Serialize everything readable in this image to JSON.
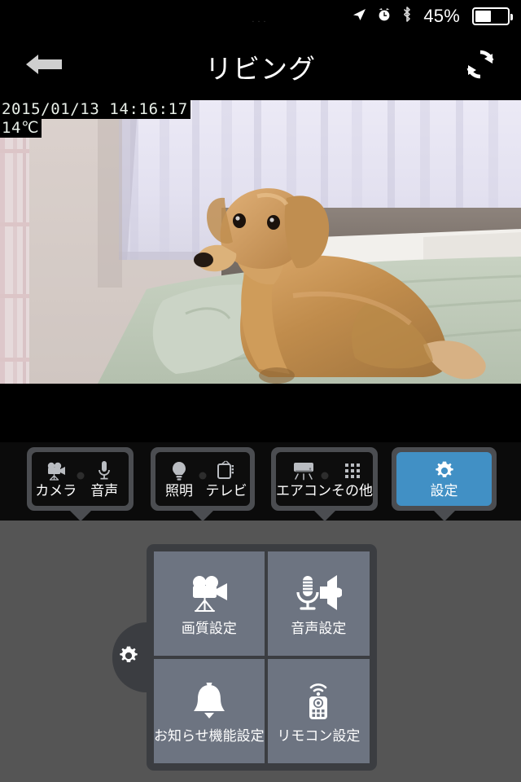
{
  "status_bar": {
    "carrier_dots": "...",
    "battery_percent": "45%",
    "battery_level": 45,
    "icons": [
      "location-arrow-icon",
      "alarm-clock-icon",
      "bluetooth-icon",
      "battery-icon"
    ]
  },
  "nav": {
    "title": "リビング",
    "back_icon": "back-arrow-icon",
    "refresh_icon": "refresh-icon"
  },
  "video": {
    "timestamp": "2015/01/13 14:16:17",
    "temperature": "14℃",
    "scene_description": "living room camera feed"
  },
  "tabs": [
    {
      "id": "camera-audio",
      "active": false,
      "cells": [
        {
          "label": "カメラ",
          "icon": "video-camera-icon"
        },
        {
          "label": "音声",
          "icon": "microphone-icon"
        }
      ]
    },
    {
      "id": "light-tv",
      "active": false,
      "cells": [
        {
          "label": "照明",
          "icon": "lightbulb-icon"
        },
        {
          "label": "テレビ",
          "icon": "television-icon"
        }
      ]
    },
    {
      "id": "aircon-other",
      "active": false,
      "cells": [
        {
          "label": "エアコン",
          "icon": "air-conditioner-icon"
        },
        {
          "label": "その他",
          "icon": "grid-dots-icon"
        }
      ]
    },
    {
      "id": "settings",
      "active": true,
      "cells": [
        {
          "label": "設定",
          "icon": "gear-icon"
        }
      ]
    }
  ],
  "settings_panel": {
    "handle_icon": "gear-icon",
    "tiles": [
      {
        "label": "画質設定",
        "icon": "video-camera-icon"
      },
      {
        "label": "音声設定",
        "icon": "microphone-speaker-icon"
      },
      {
        "label": "お知らせ機能設定",
        "icon": "bell-icon"
      },
      {
        "label": "リモコン設定",
        "icon": "remote-control-icon"
      }
    ]
  },
  "colors": {
    "accent_blue": "#4190c5",
    "panel_dark": "#3b3d41",
    "tile_gray": "#6d7481",
    "background_gray": "#555555",
    "tab_frame": "#4b4d51"
  }
}
